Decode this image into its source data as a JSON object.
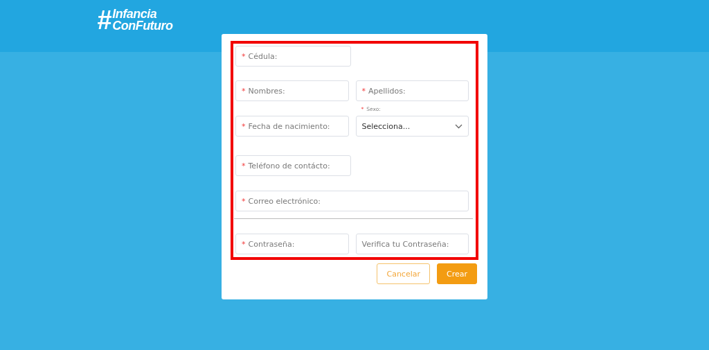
{
  "logo": {
    "hashtag": "#",
    "line_1": "Infancia",
    "line_2": "ConFuturo"
  },
  "form": {
    "highlighted": true,
    "rows": [
      {
        "fields": [
          {
            "kind": "text",
            "marker": "*",
            "placeholder": "Cédula:"
          }
        ]
      },
      {
        "fields": [
          {
            "kind": "text",
            "marker": "*",
            "placeholder": "Nombres:"
          },
          {
            "kind": "text",
            "marker": "*",
            "placeholder": "Apellidos:"
          }
        ]
      },
      {
        "fields": [
          {
            "kind": "text",
            "marker": "*",
            "placeholder": "Fecha de nacimiento:"
          },
          {
            "kind": "select",
            "marker": "*",
            "label": "Sexo:",
            "value": "Selecciona..."
          }
        ]
      },
      {
        "fields": [
          {
            "kind": "text",
            "marker": "*",
            "placeholder": "Teléfono de contácto:"
          }
        ]
      },
      {
        "fields": [
          {
            "kind": "wide",
            "marker": "*",
            "placeholder": "Correo electrónico:"
          }
        ]
      },
      {
        "divider": true,
        "fields": [
          {
            "kind": "text",
            "marker": "*",
            "placeholder": "Contraseña:"
          },
          {
            "kind": "text",
            "placeholder": "Verifica tu Contraseña:"
          }
        ]
      }
    ]
  },
  "buttons": [
    {
      "kind": "secondary",
      "label": "Cancelar"
    },
    {
      "kind": "primary",
      "label": "Crear"
    }
  ]
}
